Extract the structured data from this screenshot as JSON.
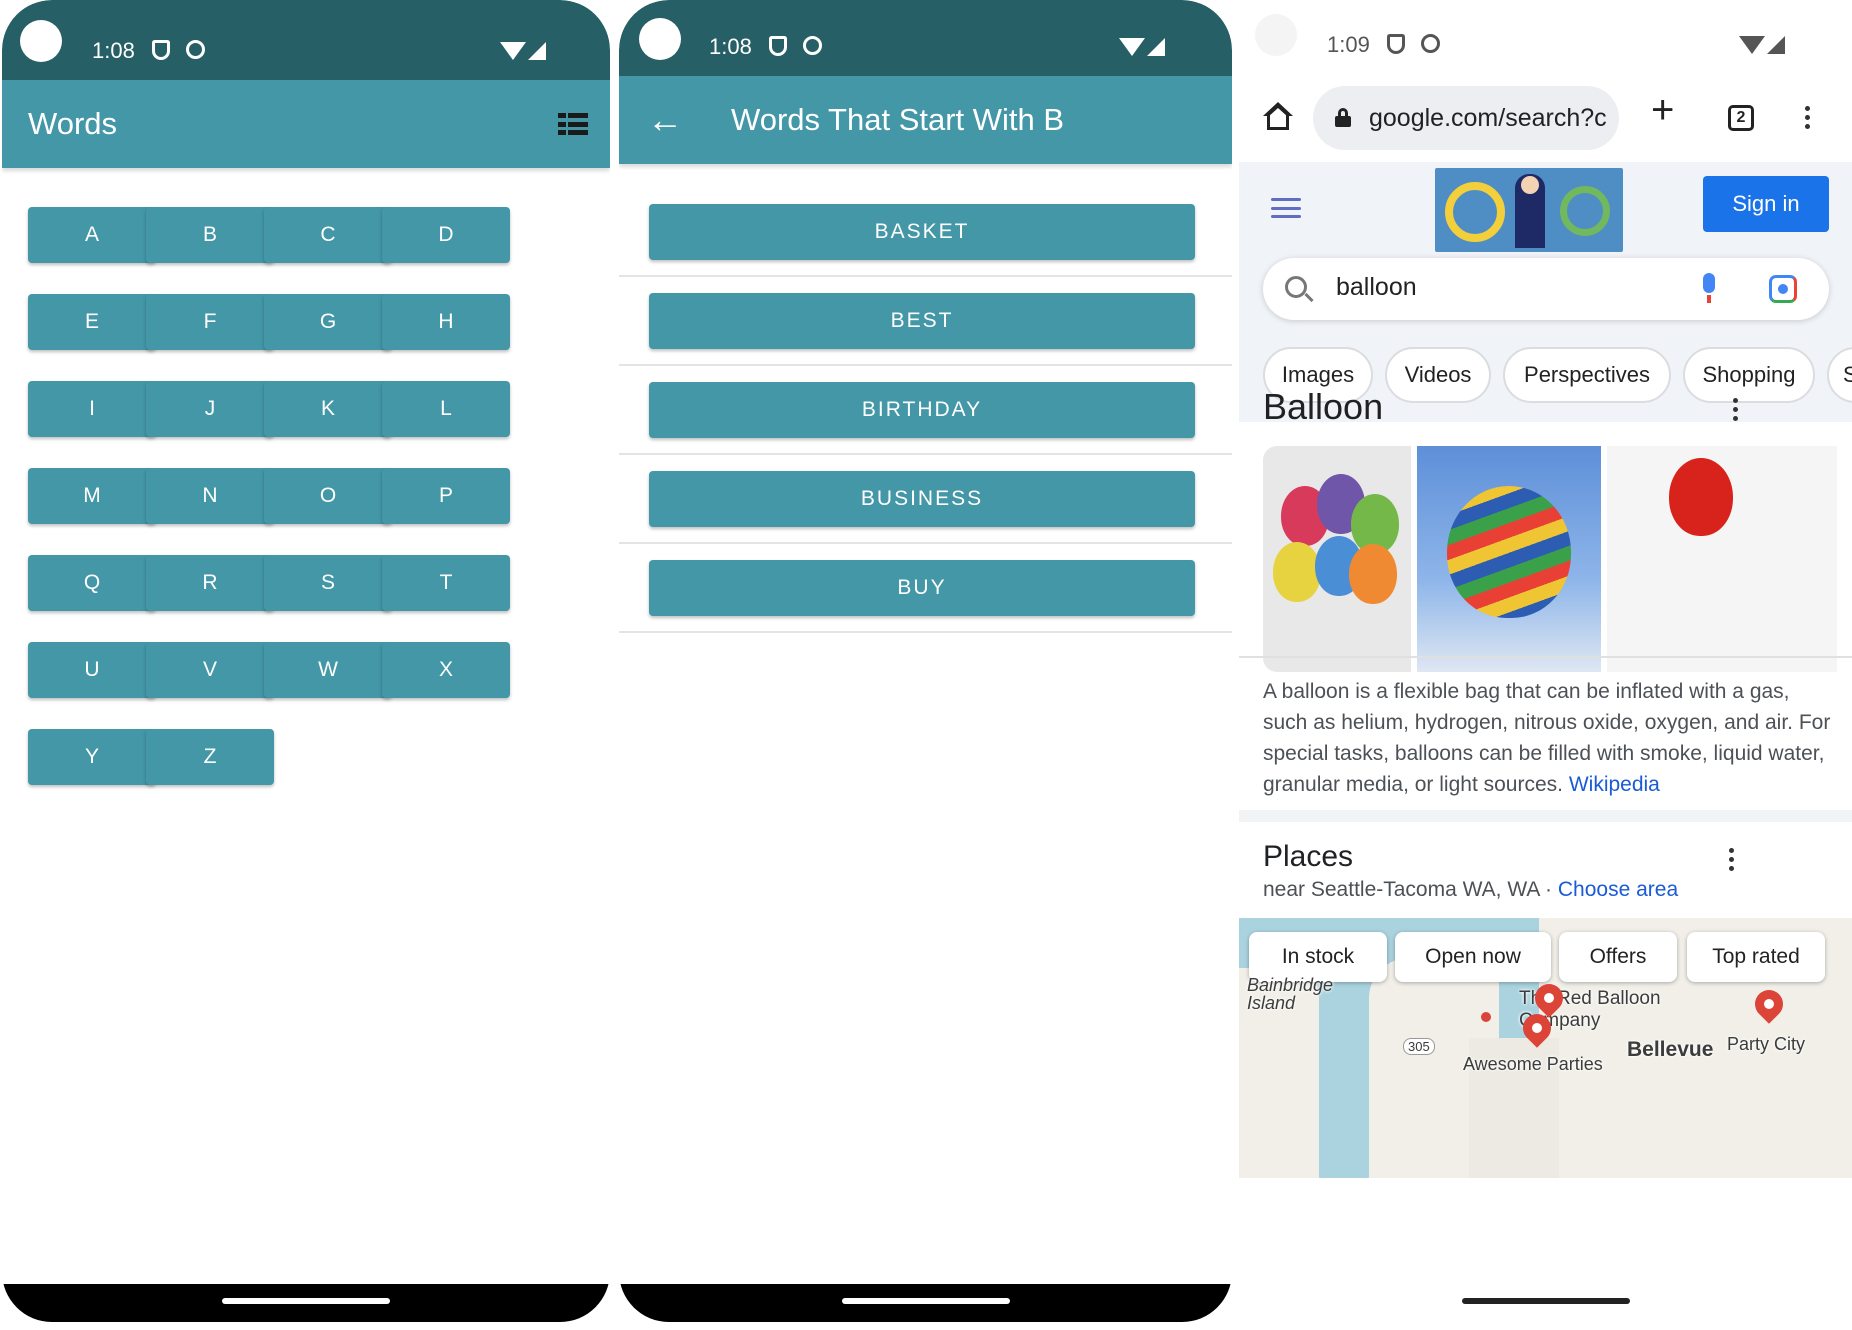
{
  "screen1": {
    "status": {
      "time": "1:08"
    },
    "appbar": {
      "title": "Words"
    },
    "letters": [
      "A",
      "B",
      "C",
      "D",
      "E",
      "F",
      "G",
      "H",
      "I",
      "J",
      "K",
      "L",
      "M",
      "N",
      "O",
      "P",
      "Q",
      "R",
      "S",
      "T",
      "U",
      "V",
      "W",
      "X",
      "Y",
      "Z"
    ]
  },
  "screen2": {
    "status": {
      "time": "1:08"
    },
    "appbar": {
      "title": "Words That Start With B"
    },
    "words": [
      "BASKET",
      "BEST",
      "BIRTHDAY",
      "BUSINESS",
      "BUY"
    ]
  },
  "screen3": {
    "status": {
      "time": "1:09"
    },
    "url": "google.com/search?c",
    "tab_count": "2",
    "sign_in": "Sign in",
    "search_query": "balloon",
    "chips": [
      "Images",
      "Videos",
      "Perspectives",
      "Shopping",
      "S"
    ],
    "kp_title": "Balloon",
    "description": "A balloon is a flexible bag that can be inflated with a gas, such as helium, hydrogen, nitrous oxide, oxygen, and air. For special tasks, balloons can be filled with smoke, liquid water, granular media, or light sources.",
    "description_link": "Wikipedia",
    "places_title": "Places",
    "places_near": "near Seattle-Tacoma WA, WA · ",
    "choose_area": "Choose area",
    "map_filters": [
      "In stock",
      "Open now",
      "Offers",
      "Top rated"
    ],
    "map_labels": {
      "bainbridge": "Bainbridge Island",
      "red_balloon": "The Red Balloon Company",
      "bellevue": "Bellevue",
      "party_city": "Party City",
      "awesome": "Awesome Parties",
      "route": "305"
    },
    "colors": {
      "accent": "#1a73e8",
      "link": "#1a5bd6"
    }
  },
  "colors": {
    "primary": "#4397a6",
    "status_dark": "#275f66"
  }
}
